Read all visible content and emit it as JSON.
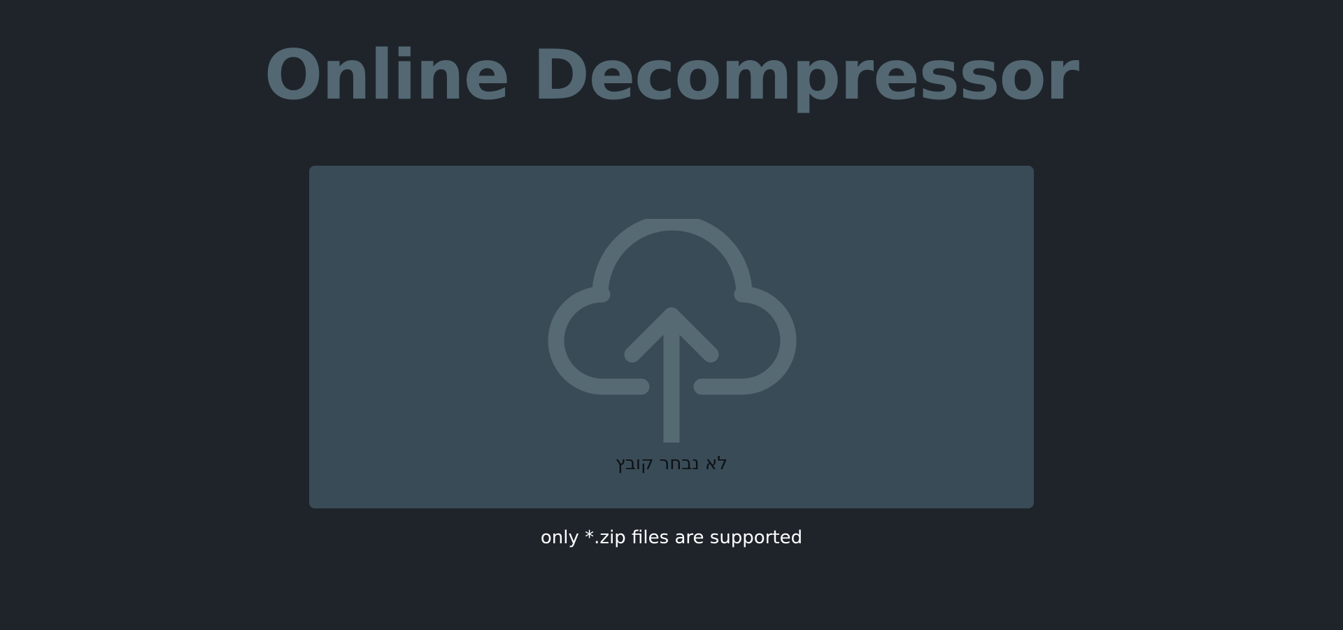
{
  "header": {
    "title": "Online Decompressor"
  },
  "upload": {
    "icon": "cloud-upload-icon",
    "file_status": "לא נבחר קובץ",
    "accepted_types": ".zip"
  },
  "hint": {
    "text": "only *.zip files are supported"
  },
  "colors": {
    "background": "#1f242b",
    "title": "#536873",
    "dropzone": "#394b56",
    "icon": "#566a74"
  }
}
